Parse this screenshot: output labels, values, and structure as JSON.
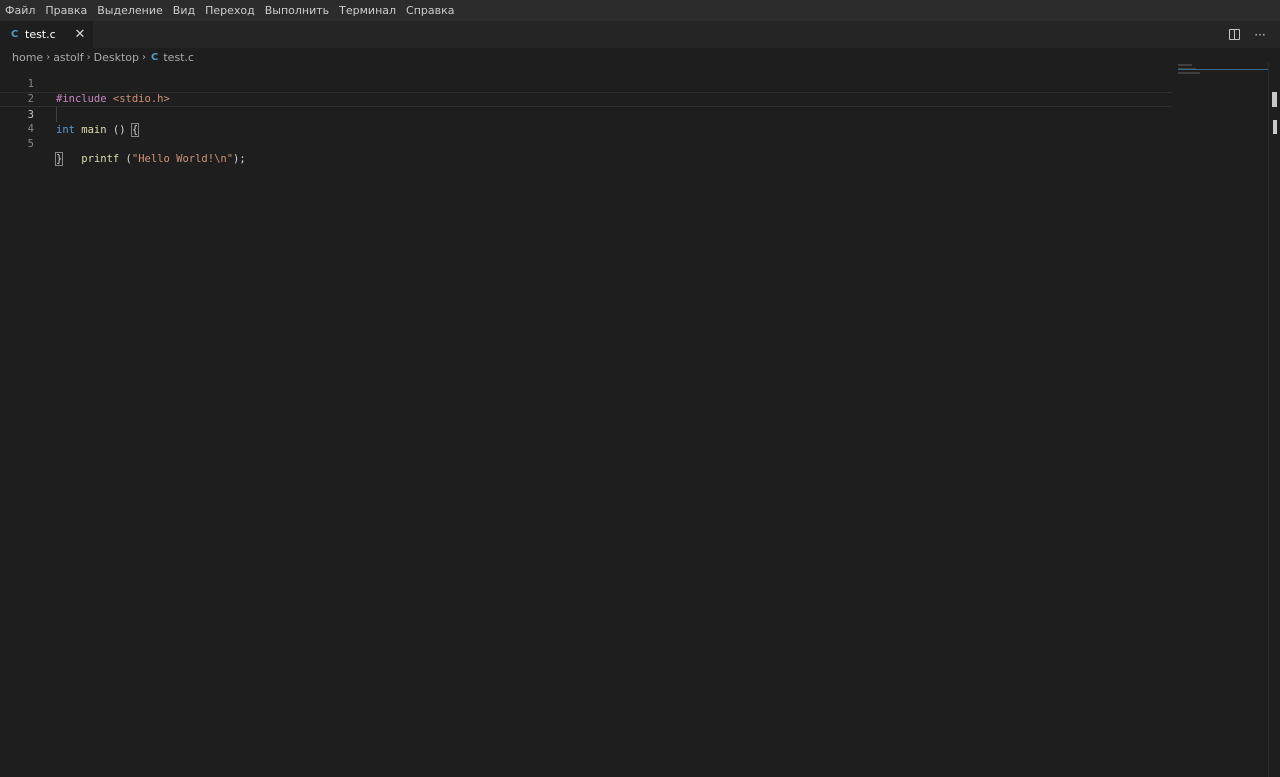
{
  "menu": [
    "Файл",
    "Правка",
    "Выделение",
    "Вид",
    "Переход",
    "Выполнить",
    "Терминал",
    "Справка"
  ],
  "tab": {
    "icon_text": "C",
    "label": "test.c",
    "close": "✕"
  },
  "tab_actions": {
    "more": "···"
  },
  "breadcrumb": {
    "home": "home",
    "user": "astolf",
    "dir": "Desktop",
    "file_icon": "C",
    "file": "test.c",
    "sep": "›"
  },
  "editor": {
    "line_numbers": [
      "1",
      "2",
      "3",
      "4",
      "5"
    ],
    "line1": {
      "pre": "#include",
      "rest": " <stdio.h>"
    },
    "line3": {
      "kw": "int",
      "fn": " main",
      "rest": " () ",
      "brace": "{"
    },
    "line4": {
      "indent": "    ",
      "fn": "printf",
      "open": " (",
      "str": "\"Hello World!\\n\"",
      "close": ");"
    },
    "line5": {
      "brace": "}"
    }
  },
  "colors": {
    "background": "#1e1e1e",
    "menubar": "#2c2c2c",
    "keyword": "#569cd6",
    "preprocessor": "#c586c0",
    "function": "#dcdcaa",
    "string": "#ce9178",
    "c_icon": "#519aba"
  }
}
